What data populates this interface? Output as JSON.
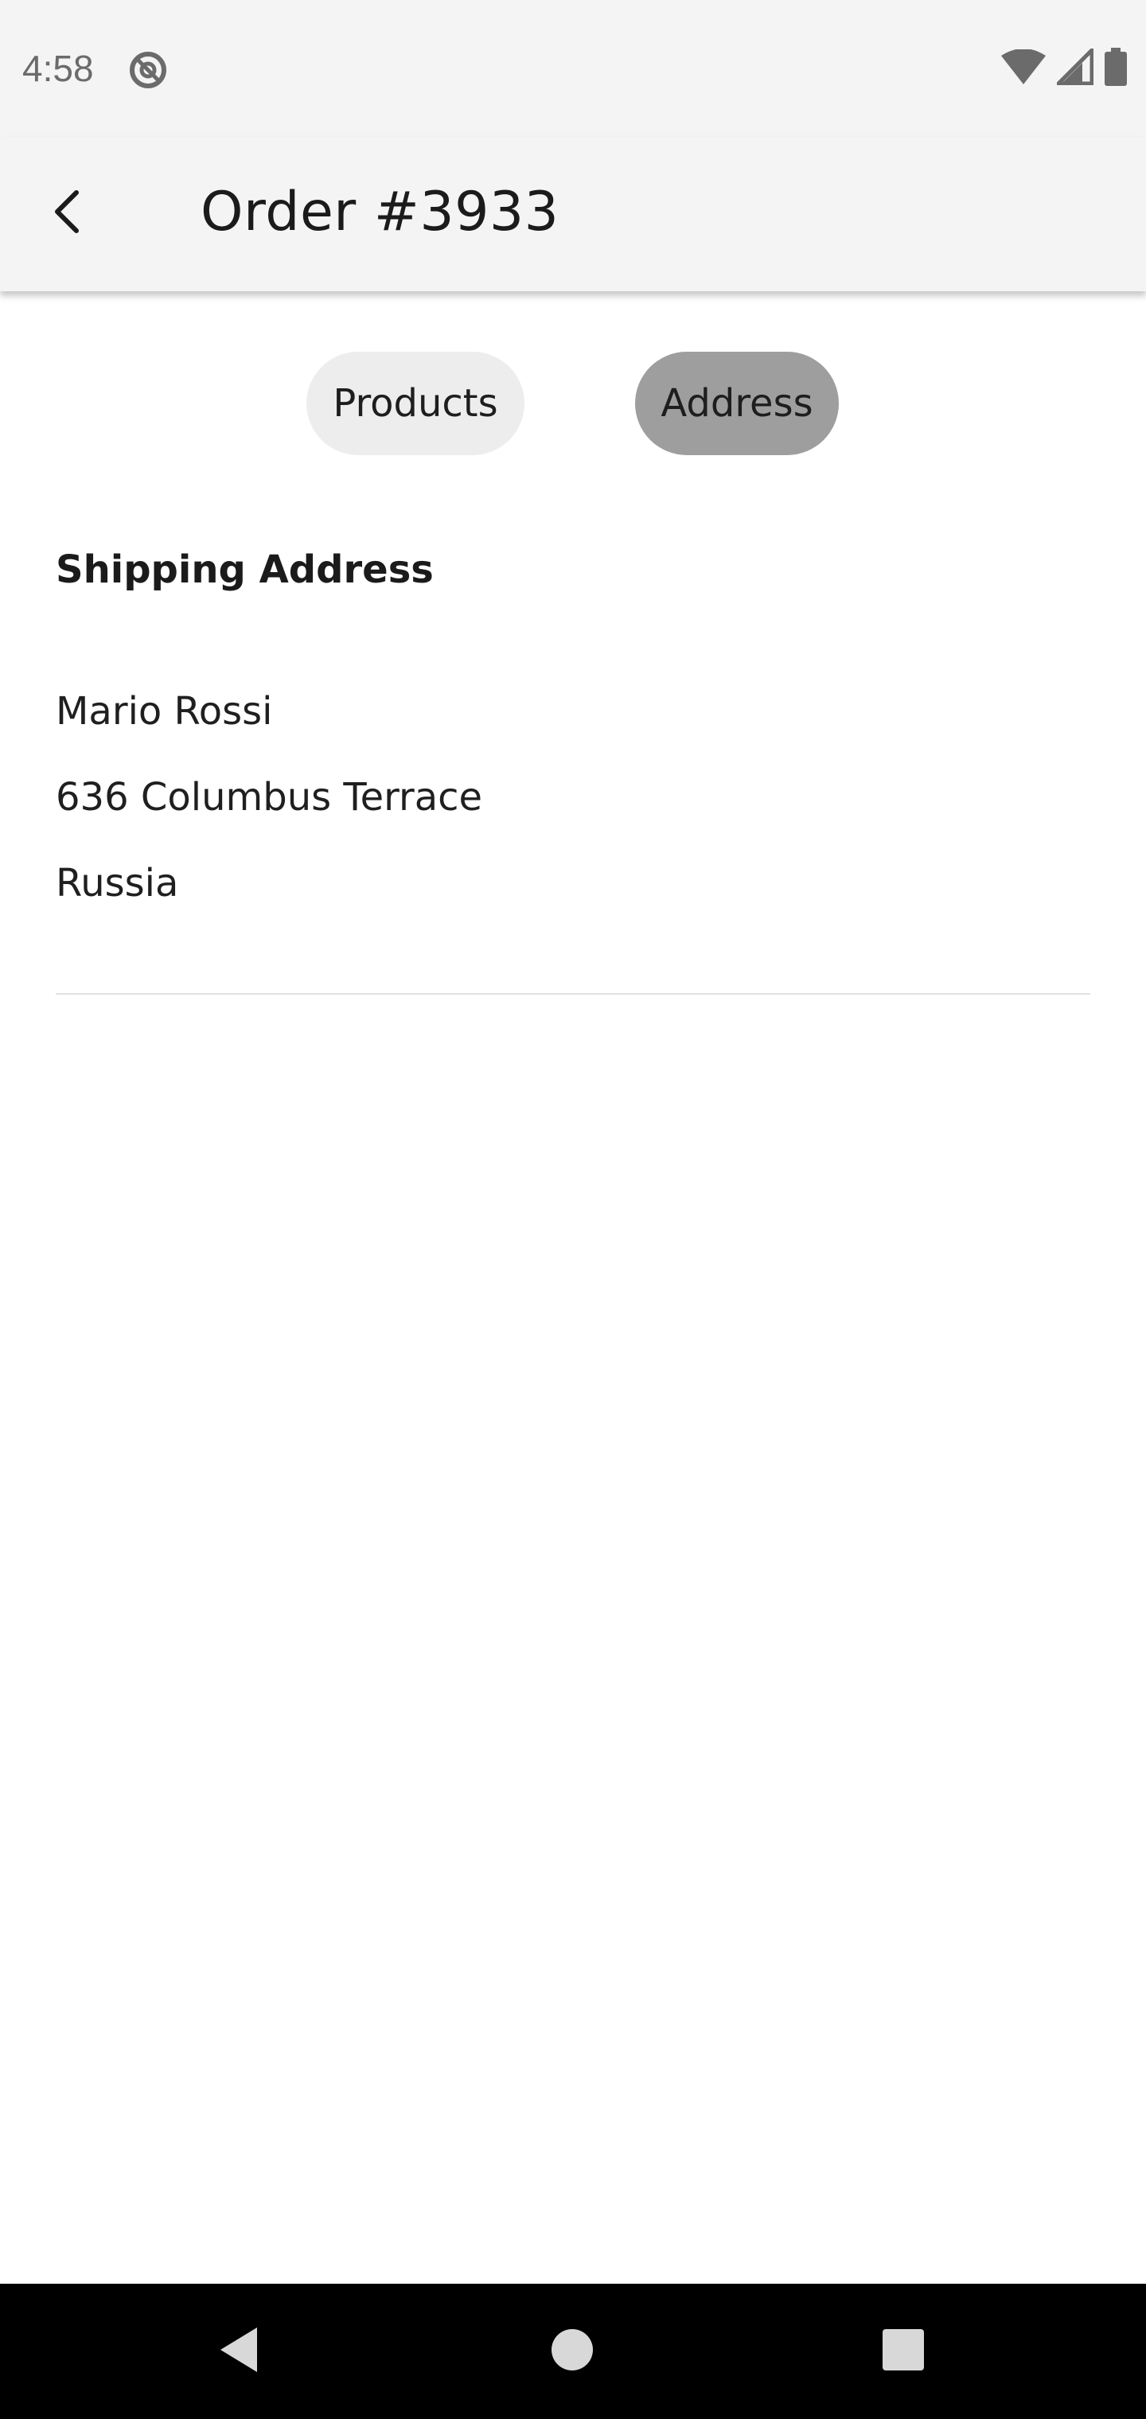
{
  "status_bar": {
    "time": "4:58",
    "icons": [
      "app-notification-icon",
      "wifi-icon",
      "cellular-signal-icon",
      "battery-icon"
    ]
  },
  "app_bar": {
    "back_icon": "chevron-left-icon",
    "title": "Order #3933"
  },
  "tabs": [
    {
      "label": "Products",
      "selected": false
    },
    {
      "label": "Address",
      "selected": true
    }
  ],
  "shipping": {
    "heading": "Shipping Address",
    "name": "Mario Rossi",
    "street": "636 Columbus Terrace",
    "country": "Russia"
  },
  "nav_bar": {
    "icons": [
      "back-triangle-icon",
      "home-circle-icon",
      "recents-square-icon"
    ]
  },
  "colors": {
    "bar_background": "#f4f4f4",
    "tab_unselected": "#ededed",
    "tab_selected": "#9e9e9e",
    "nav_background": "#000000"
  }
}
